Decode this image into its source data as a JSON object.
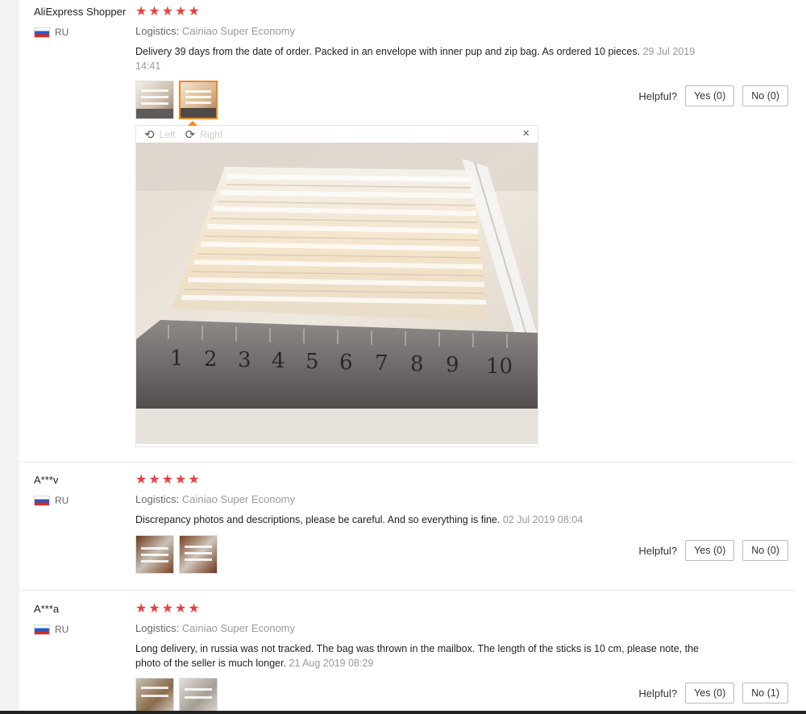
{
  "helpful_label": "Helpful?",
  "viewer": {
    "left_label": "Left",
    "right_label": "Right",
    "rotate_left_icon": "⟲",
    "rotate_right_icon": "⟳",
    "close_icon": "×",
    "ruler_numbers": [
      "1",
      "2",
      "3",
      "4",
      "5",
      "6",
      "7",
      "8",
      "9",
      "10"
    ]
  },
  "reviews": [
    {
      "buyer": "AliExpress Shopper",
      "country": "RU",
      "stars": 5,
      "logistics_label": "Logistics:",
      "logistics_value": "Cainiao Super Economy",
      "text": "Delivery 39 days from the date of order. Packed in an envelope with inner pup and zip bag. As ordered 10 pieces.",
      "date": "29 Jul 2019 14:41",
      "yes": "Yes (0)",
      "no": "No (0)"
    },
    {
      "buyer": "A***v",
      "country": "RU",
      "stars": 5,
      "logistics_label": "Logistics:",
      "logistics_value": "Cainiao Super Economy",
      "text": "Discrepancy photos and descriptions, please be careful. And so everything is fine.",
      "date": "02 Jul 2019 08:04",
      "yes": "Yes (0)",
      "no": "No (0)"
    },
    {
      "buyer": "A***a",
      "country": "RU",
      "stars": 5,
      "logistics_label": "Logistics:",
      "logistics_value": "Cainiao Super Economy",
      "text": "Long delivery, in russia was not tracked. The bag was thrown in the mailbox. The length of the sticks is 10 cm, please note, the photo of the seller is much longer.",
      "date": "21 Aug 2019 08:29",
      "yes": "Yes (0)",
      "no": "No (1)"
    }
  ],
  "colors": {
    "star": "#e64340",
    "selected_thumb": "#f2861f",
    "muted": "#999999"
  }
}
